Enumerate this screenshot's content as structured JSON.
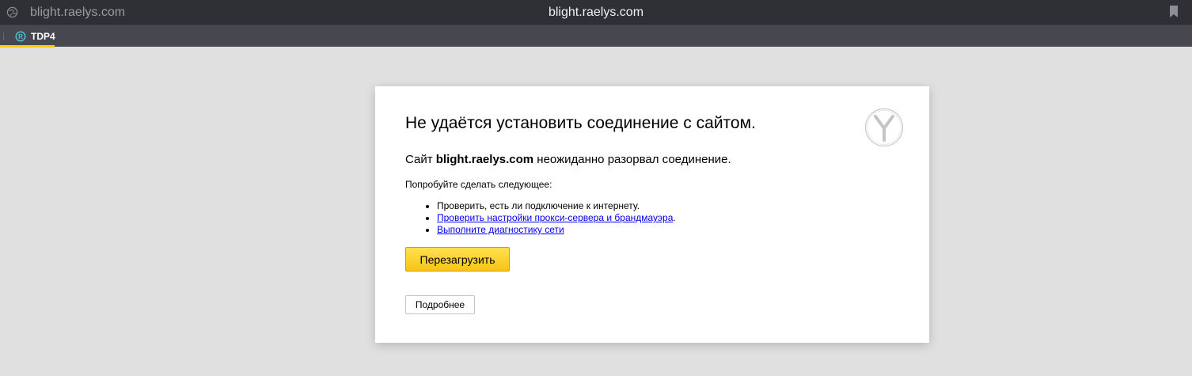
{
  "browser": {
    "url_display": "blight.raelys.com",
    "page_title": "blight.raelys.com",
    "icons": {
      "site_info": "globe-icon",
      "bookmark": "bookmark-icon"
    }
  },
  "tabs": [
    {
      "label": "TDP4",
      "favicon": "tdp4-favicon-icon",
      "active": true,
      "accent_color": "#ffcc00"
    }
  ],
  "error_page": {
    "title": "Не удаётся установить соединение с сайтом.",
    "message_prefix": "Сайт ",
    "host": "blight.raelys.com",
    "message_suffix": " неожиданно разорвал соединение.",
    "try_heading": "Попробуйте сделать следующее:",
    "suggestions": [
      {
        "text": "Проверить, есть ли подключение к интернету.",
        "link": false
      },
      {
        "text": "Проверить настройки прокси-сервера и брандмауэра",
        "link": true,
        "suffix": "."
      },
      {
        "text": "Выполните диагностику сети",
        "link": true
      }
    ],
    "reload_label": "Перезагрузить",
    "details_label": "Подробнее",
    "logo": "yandex-browser-logo-icon"
  },
  "colors": {
    "page_background": "#e0e0e0",
    "topbar_background": "#2f2f36",
    "tabbar_background": "#47474f",
    "reload_button": "#ffd829",
    "link": "#0000ee"
  }
}
